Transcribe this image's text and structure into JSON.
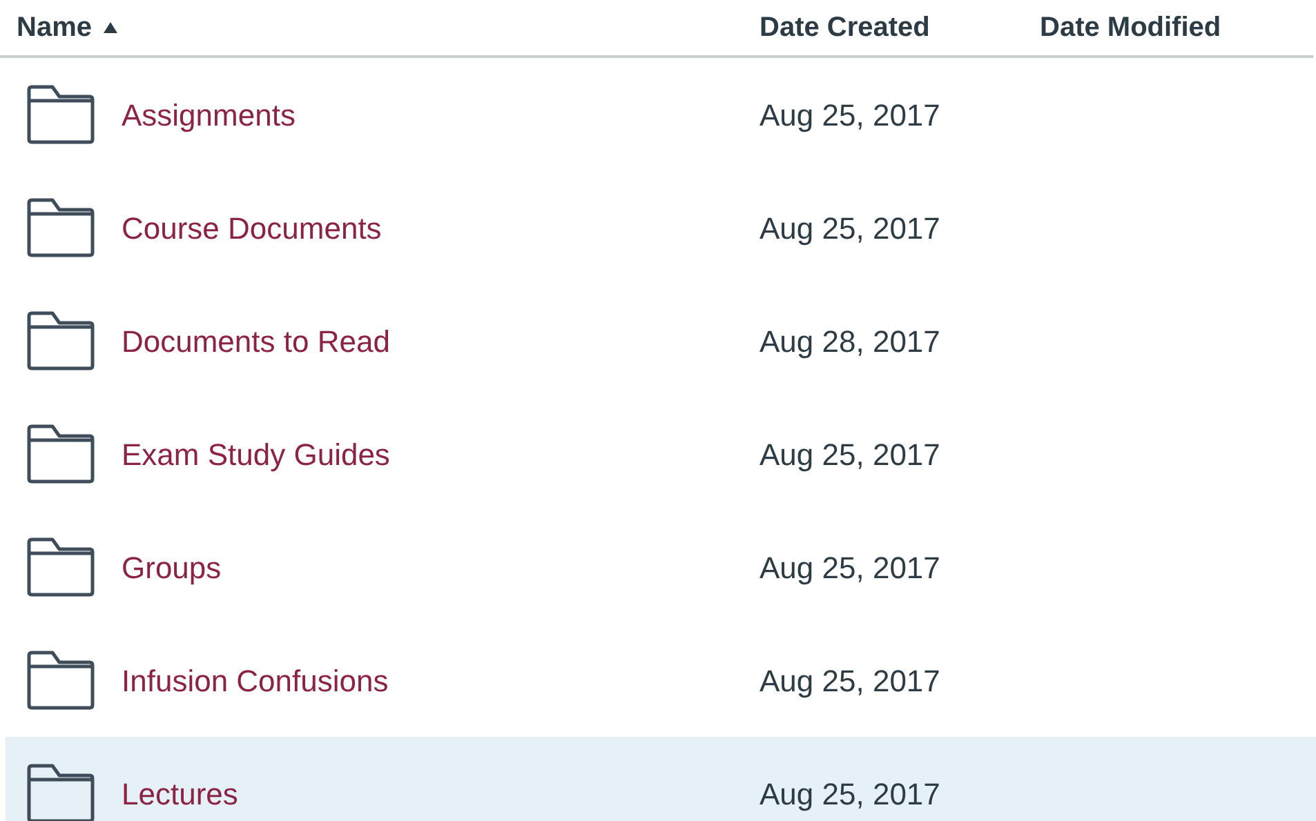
{
  "table": {
    "columns": [
      {
        "label": "Name",
        "sorted": true
      },
      {
        "label": "Date Created",
        "sorted": false
      },
      {
        "label": "Date Modified",
        "sorted": false
      }
    ],
    "rows": [
      {
        "name": "Assignments",
        "date_created": "Aug 25, 2017",
        "selected": false
      },
      {
        "name": "Course Documents",
        "date_created": "Aug 25, 2017",
        "selected": false
      },
      {
        "name": "Documents to Read",
        "date_created": "Aug 28, 2017",
        "selected": false
      },
      {
        "name": "Exam Study Guides",
        "date_created": "Aug 25, 2017",
        "selected": false
      },
      {
        "name": "Groups",
        "date_created": "Aug 25, 2017",
        "selected": false
      },
      {
        "name": "Infusion Confusions",
        "date_created": "Aug 25, 2017",
        "selected": false
      },
      {
        "name": "Lectures",
        "date_created": "Aug 25, 2017",
        "selected": true
      }
    ]
  }
}
